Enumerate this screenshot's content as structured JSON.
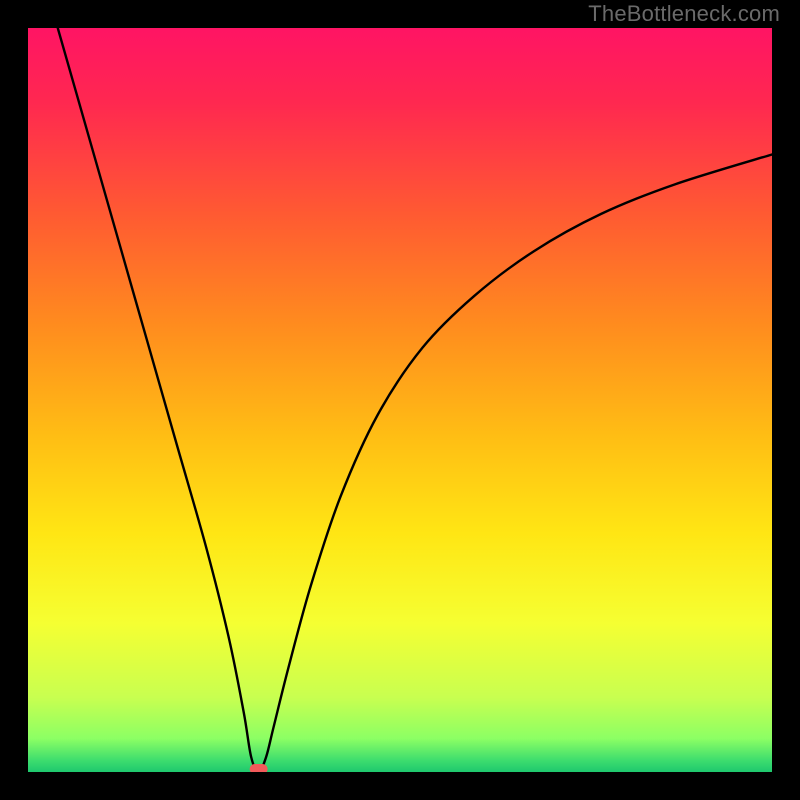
{
  "watermark": "TheBottleneck.com",
  "chart_data": {
    "type": "line",
    "title": "",
    "xlabel": "",
    "ylabel": "",
    "xlim": [
      0,
      100
    ],
    "ylim": [
      0,
      100
    ],
    "grid": false,
    "legend": false,
    "notes": "Gradient background (green at bottom through yellow/orange to red/pink at top) represents bottleneck severity. A single black V-shaped curve dips to ~0% near x≈31, with a small red segment at the trough.",
    "series": [
      {
        "name": "bottleneck-curve",
        "x": [
          4,
          8,
          12,
          16,
          20,
          24,
          27,
          29,
          30,
          31,
          32,
          33,
          35,
          38,
          42,
          47,
          53,
          60,
          68,
          77,
          87,
          100
        ],
        "values": [
          100,
          86,
          72,
          58,
          44,
          30,
          18,
          8,
          2,
          0,
          2,
          6,
          14,
          25,
          37,
          48,
          57,
          64,
          70,
          75,
          79,
          83
        ]
      }
    ],
    "marker": {
      "x": 31,
      "y": 0,
      "color": "#f25a5a"
    },
    "gradient_stops": [
      {
        "offset": 0.0,
        "color": "#ff1464"
      },
      {
        "offset": 0.1,
        "color": "#ff2850"
      },
      {
        "offset": 0.25,
        "color": "#ff5a32"
      },
      {
        "offset": 0.4,
        "color": "#ff8c1e"
      },
      {
        "offset": 0.55,
        "color": "#ffbe14"
      },
      {
        "offset": 0.68,
        "color": "#ffe614"
      },
      {
        "offset": 0.8,
        "color": "#f5ff32"
      },
      {
        "offset": 0.9,
        "color": "#c8ff50"
      },
      {
        "offset": 0.955,
        "color": "#8cff64"
      },
      {
        "offset": 0.985,
        "color": "#3cdc6e"
      },
      {
        "offset": 1.0,
        "color": "#1ec86e"
      }
    ]
  }
}
